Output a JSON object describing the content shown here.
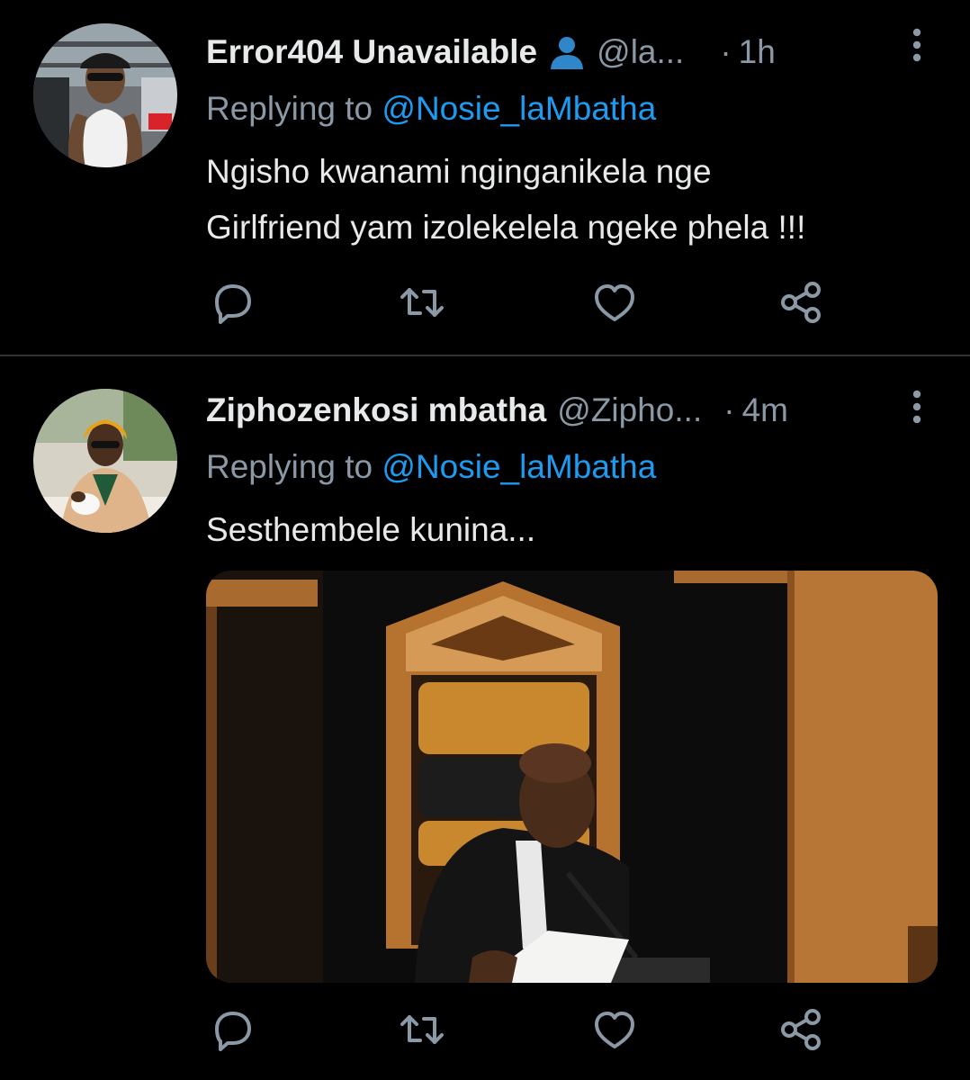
{
  "colors": {
    "background": "#000000",
    "text": "#e7e9ea",
    "secondary_text": "#8b98a5",
    "accent": "#1d9bf0",
    "divider": "#2f3336"
  },
  "tweets": [
    {
      "display_name": "Error404 Unavailable",
      "badge_icon": "person-emoji-icon",
      "handle": "@la...",
      "separator": "·",
      "time": "1h",
      "reply_prefix": "Replying to",
      "reply_to": "@Nosie_laMbatha",
      "text_line1": "Ngisho kwanami nginganikela nge",
      "text_line2": "Girlfriend yam izolekelela ngeke phela !!!",
      "avatar_icon": "user-avatar-photo"
    },
    {
      "display_name": "Ziphozenkosi mbatha",
      "handle": "@Zipho...",
      "separator": "·",
      "time": "4m",
      "reply_prefix": "Replying to",
      "reply_to": "@Nosie_laMbatha",
      "text_line1": "Sesthembele kunina...",
      "avatar_icon": "user-avatar-photo",
      "media_icon": "attached-photo-speaker-chair"
    }
  ],
  "action_icons": [
    "reply-icon",
    "retweet-icon",
    "like-icon",
    "share-icon"
  ]
}
